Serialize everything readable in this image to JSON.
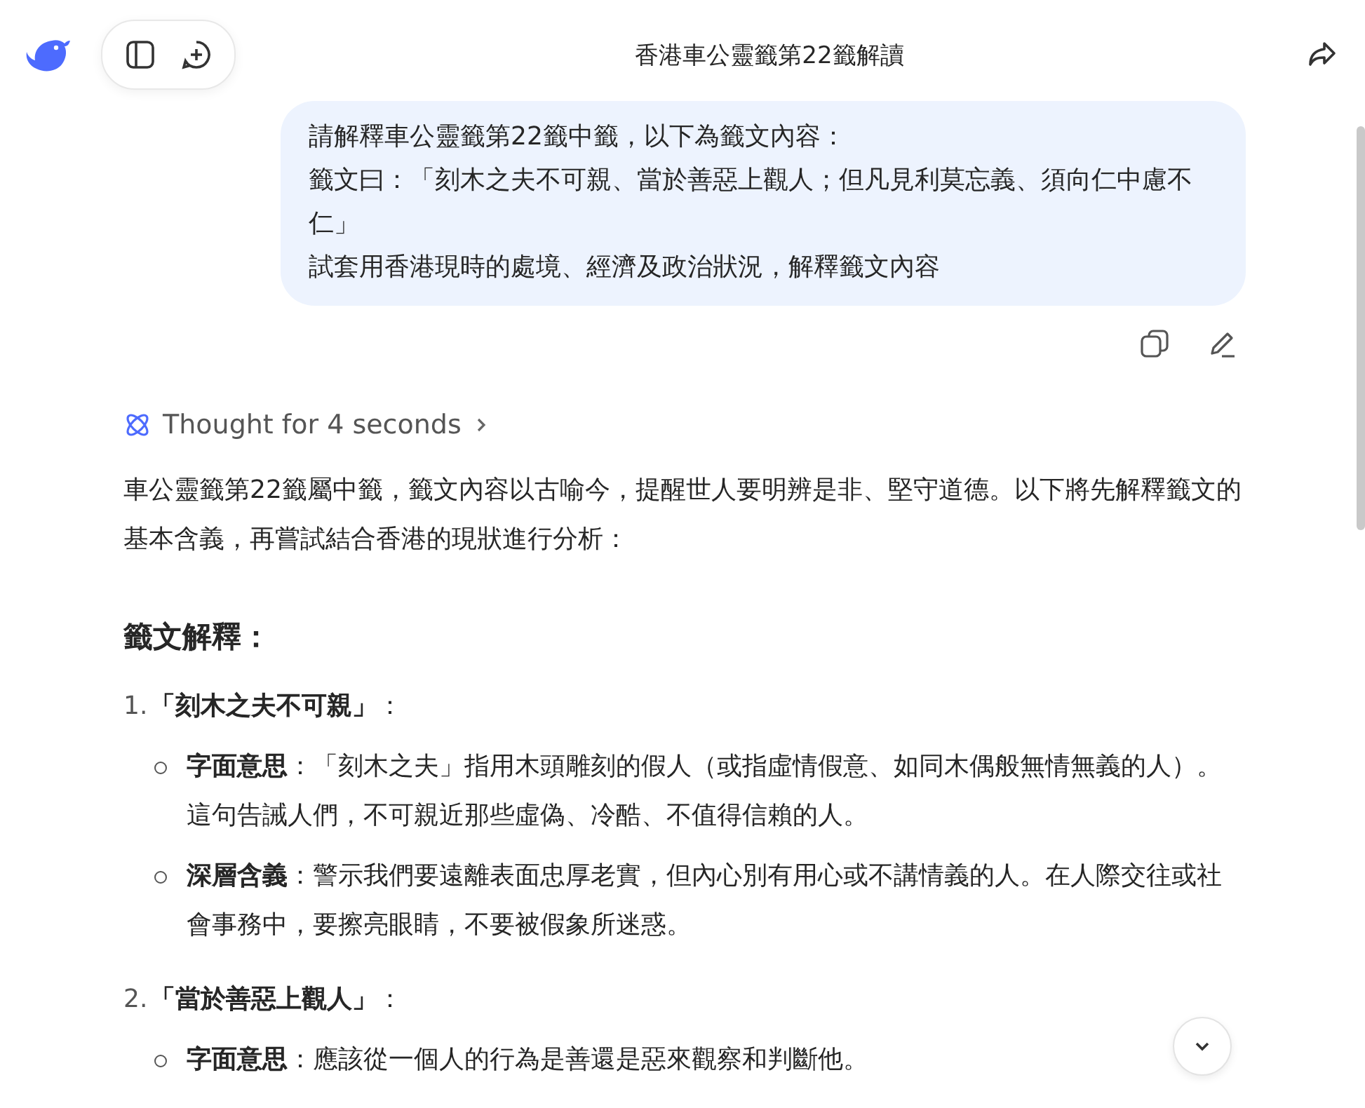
{
  "header": {
    "title": "香港車公靈籤第22籤解讀"
  },
  "user_message": {
    "lines": [
      "請解釋車公靈籤第22籤中籤，以下為籤文內容：",
      "籤文曰：「刻木之夫不可親、當於善惡上觀人；但凡見利莫忘義、須向仁中慮不仁」",
      "試套用香港現時的處境、經濟及政治狀況，解釋籤文內容"
    ]
  },
  "thought": {
    "label": "Thought for 4 seconds",
    "expanded": false
  },
  "answer": {
    "intro": "車公靈籤第22籤屬中籤，籤文內容以古喻今，提醒世人要明辨是非、堅守道德。以下將先解釋籤文的基本含義，再嘗試結合香港的現狀進行分析：",
    "heading": "籤文解釋：",
    "items": [
      {
        "number": "1.",
        "title": "**「刻木之夫不可親」**：",
        "bullets": [
          "**字面意思**：「刻木之夫」指用木頭雕刻的假人（或指虛情假意、如同木偶般無情無義的人）。這句告誡人們，不可親近那些虛偽、冷酷、不值得信賴的人。",
          "**深層含義**：警示我們要遠離表面忠厚老實，但內心別有用心或不講情義的人。在人際交往或社會事務中，要擦亮眼睛，不要被假象所迷惑。"
        ]
      },
      {
        "number": "2.",
        "title": "**「當於善惡上觀人」**：",
        "bullets": [
          "**字面意思**：應該從一個人的行為是善還是惡來觀察和判斷他。"
        ]
      }
    ]
  }
}
